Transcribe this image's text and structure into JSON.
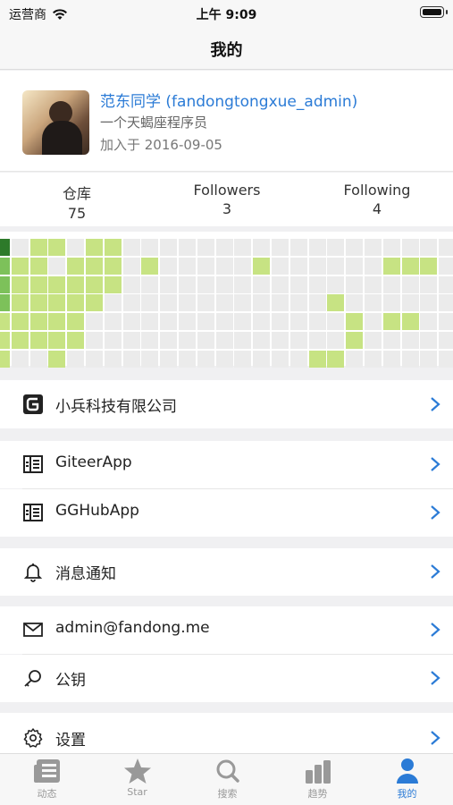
{
  "status_bar": {
    "carrier": "运营商",
    "time": "上午 9:09"
  },
  "nav": {
    "title": "我的"
  },
  "profile": {
    "name": "范东同学 (fandongtongxue_admin)",
    "bio": "一个天蝎座程序员",
    "joined": "加入于 2016-09-05"
  },
  "stats": [
    {
      "label": "仓库",
      "value": "75"
    },
    {
      "label": "Followers",
      "value": "3"
    },
    {
      "label": "Following",
      "value": "4"
    }
  ],
  "contributions": {
    "colors": {
      "none": "#ebebeb",
      "light": "#c7e383",
      "medium": "#7dc15a",
      "dark": "#2d7a2a"
    },
    "grid": [
      "d.ll.ll................",
      "mll.lll.l.....l......lll",
      "mllllll.................",
      "mlllll............l.....",
      "lllll..............l.ll.",
      "lllll..............l....",
      "l..l.............ll....."
    ]
  },
  "menu": [
    {
      "label": "小兵科技有限公司",
      "icon": "gitee-org-icon"
    },
    {
      "label": "GiteerApp",
      "icon": "repo-icon"
    },
    {
      "label": "GGHubApp",
      "icon": "repo-icon"
    },
    {
      "label": "消息通知",
      "icon": "bell-icon"
    },
    {
      "label": "admin@fandong.me",
      "icon": "mail-icon"
    },
    {
      "label": "公钥",
      "icon": "key-icon"
    },
    {
      "label": "设置",
      "icon": "gear-icon"
    }
  ],
  "tabs": [
    {
      "label": "动态",
      "icon": "feed-icon",
      "active": false
    },
    {
      "label": "Star",
      "icon": "star-icon",
      "active": false
    },
    {
      "label": "搜索",
      "icon": "search-icon",
      "active": false
    },
    {
      "label": "趋势",
      "icon": "trend-icon",
      "active": false
    },
    {
      "label": "我的",
      "icon": "person-icon",
      "active": true
    }
  ],
  "accent": "#2b7bd6"
}
